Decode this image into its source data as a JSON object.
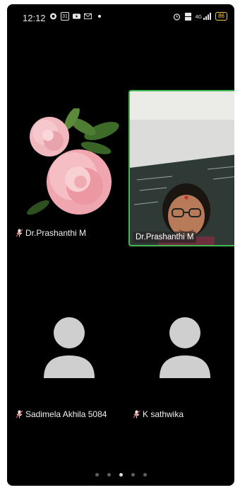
{
  "status_bar": {
    "time": "12:12",
    "left_icons": [
      "chat-bubble-icon",
      "calendar-icon",
      "youtube-icon",
      "gmail-icon",
      "dot-icon"
    ],
    "calendar_day": "31",
    "right_icons": [
      "alarm-icon",
      "volte-icon",
      "signal-icon",
      "battery-icon"
    ],
    "network": "4G",
    "battery": "86"
  },
  "participants": [
    {
      "name": "Dr.Prashanthi M",
      "muted": true,
      "tile": "flower-image"
    },
    {
      "name": "Dr.Prashanthi M",
      "muted": false,
      "tile": "camera-video",
      "active_speaker": true
    },
    {
      "name": "Sadimela Akhila 5084",
      "muted": true,
      "tile": "avatar-placeholder"
    },
    {
      "name": "K sathwika",
      "muted": true,
      "tile": "avatar-placeholder"
    }
  ],
  "pagination": {
    "pages": 5,
    "current": 3
  },
  "colors": {
    "background": "#000000",
    "active_speaker_border": "#3fb950",
    "avatar": "#cfcfcf",
    "battery": "#f2c94c"
  }
}
